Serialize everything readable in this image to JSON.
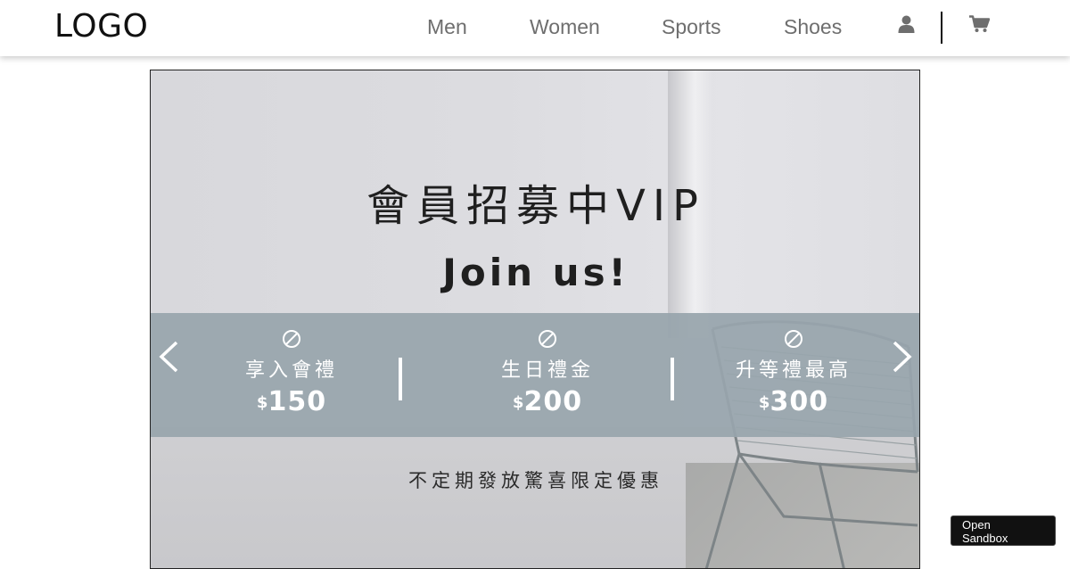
{
  "header": {
    "logo": "LOGO",
    "nav": [
      {
        "label": "Men"
      },
      {
        "label": "Women"
      },
      {
        "label": "Sports"
      },
      {
        "label": "Shoes"
      }
    ],
    "icons": [
      "user-icon",
      "cart-icon"
    ]
  },
  "banner": {
    "headline": "會員招募中VIP",
    "subhead": "Join us!",
    "benefits": [
      {
        "label": "享入會禮",
        "currency": "$",
        "amount": "150"
      },
      {
        "label": "生日禮金",
        "currency": "$",
        "amount": "200"
      },
      {
        "label": "升等禮最高",
        "currency": "$",
        "amount": "300"
      }
    ],
    "footnote": "不定期發放驚喜限定優惠",
    "band_color": "#98a5ac"
  },
  "sandbox": {
    "label_line1": "Open",
    "label_line2": "Sandbox"
  }
}
